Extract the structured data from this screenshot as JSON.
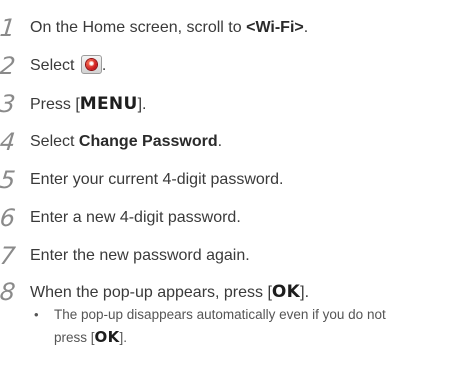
{
  "steps": [
    {
      "num": "1",
      "pre": "On the Home screen, scroll to ",
      "bold": "<Wi-Fi>",
      "post": "."
    },
    {
      "num": "2",
      "pre": "Select ",
      "icon": "wifi-app-icon",
      "post": "."
    },
    {
      "num": "3",
      "pre": "Press [",
      "key": "MENU",
      "post": "]."
    },
    {
      "num": "4",
      "pre": "Select ",
      "bold": "Change Password",
      "post": "."
    },
    {
      "num": "5",
      "text": "Enter your current 4-digit password."
    },
    {
      "num": "6",
      "text": "Enter a new 4-digit password."
    },
    {
      "num": "7",
      "text": "Enter the new password again."
    },
    {
      "num": "8",
      "pre": "When the pop-up appears, press [",
      "key": "OK",
      "post": "]."
    }
  ],
  "note": {
    "bullet": "•",
    "line1": "The pop-up disappears automatically even if you do not",
    "line2_pre": "press [",
    "key": "OK",
    "line2_post": "]."
  },
  "colors": {
    "text": "#3a3a3a",
    "step_number": "#8a8a8a",
    "icon_red": "#c8141a"
  }
}
